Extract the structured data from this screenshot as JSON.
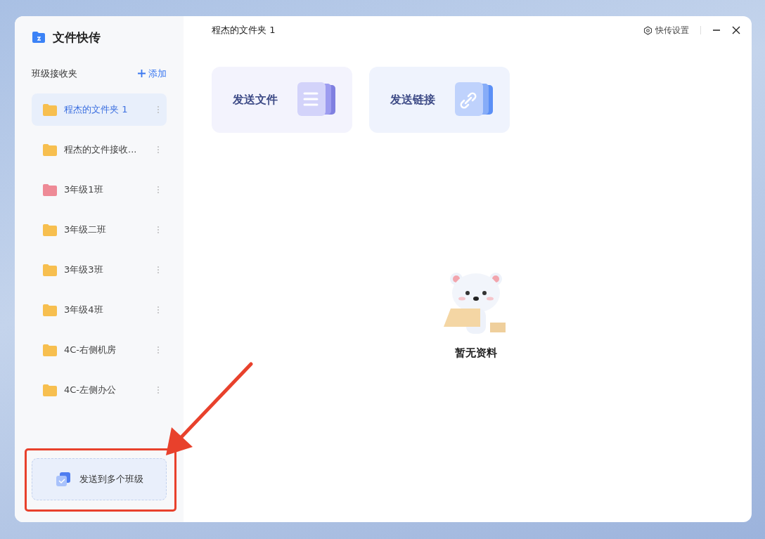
{
  "app": {
    "title": "文件快传"
  },
  "sidebar": {
    "section_title": "班级接收夹",
    "add_label": "添加",
    "items": [
      {
        "label": "程杰的文件夹 1",
        "selected": true,
        "color": "#f7bf4f"
      },
      {
        "label": "程杰的文件接收...",
        "selected": false,
        "color": "#f7bf4f"
      },
      {
        "label": "3年级1班",
        "selected": false,
        "color": "#ee8a96"
      },
      {
        "label": "3年级二班",
        "selected": false,
        "color": "#f7bf4f"
      },
      {
        "label": "3年级3班",
        "selected": false,
        "color": "#f7bf4f"
      },
      {
        "label": "3年级4班",
        "selected": false,
        "color": "#f7bf4f"
      },
      {
        "label": "4C-右侧机房",
        "selected": false,
        "color": "#f7bf4f"
      },
      {
        "label": "4C-左侧办公",
        "selected": false,
        "color": "#f7bf4f"
      }
    ],
    "bottom_button": "发送到多个班级"
  },
  "header": {
    "title": "程杰的文件夹 1",
    "settings": "快传设置"
  },
  "actions": [
    {
      "kind": "file",
      "label": "发送文件"
    },
    {
      "kind": "link",
      "label": "发送链接"
    }
  ],
  "empty_state": {
    "message": "暂无资料"
  }
}
